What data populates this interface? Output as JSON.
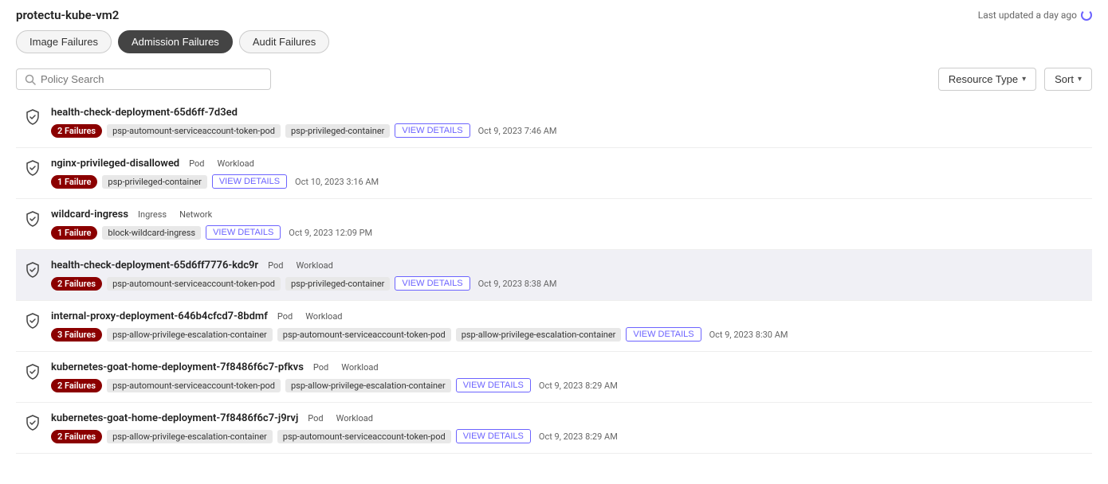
{
  "app": {
    "title": "protectu-kube-vm2",
    "last_updated": "Last updated a day ago"
  },
  "tabs": [
    {
      "id": "image-failures",
      "label": "Image Failures",
      "active": false
    },
    {
      "id": "admission-failures",
      "label": "Admission Failures",
      "active": true
    },
    {
      "id": "audit-failures",
      "label": "Audit Failures",
      "active": false
    }
  ],
  "toolbar": {
    "search_placeholder": "Policy Search",
    "resource_type_label": "Resource Type",
    "sort_label": "Sort"
  },
  "items": [
    {
      "id": "item-1",
      "name": "health-check-deployment-65d6ff-7d3ed",
      "type1": "",
      "type2": "",
      "highlighted": false,
      "failures_count": "2 Failures",
      "tags": [
        "psp-automount-serviceaccount-token-pod",
        "psp-privileged-container"
      ],
      "view_details": "VIEW DETAILS",
      "date": "Oct 9, 2023 7:46 AM"
    },
    {
      "id": "item-2",
      "name": "nginx-privileged-disallowed",
      "type1": "Pod",
      "type2": "Workload",
      "highlighted": false,
      "failures_count": "1 Failure",
      "tags": [
        "psp-privileged-container"
      ],
      "view_details": "VIEW DETAILS",
      "date": "Oct 10, 2023 3:16 AM"
    },
    {
      "id": "item-3",
      "name": "wildcard-ingress",
      "type1": "Ingress",
      "type2": "Network",
      "highlighted": false,
      "failures_count": "1 Failure",
      "tags": [
        "block-wildcard-ingress"
      ],
      "view_details": "VIEW DETAILS",
      "date": "Oct 9, 2023 12:09 PM"
    },
    {
      "id": "item-4",
      "name": "health-check-deployment-65d6ff7776-kdc9r",
      "type1": "Pod",
      "type2": "Workload",
      "highlighted": true,
      "failures_count": "2 Failures",
      "tags": [
        "psp-automount-serviceaccount-token-pod",
        "psp-privileged-container"
      ],
      "view_details": "VIEW DETAILS",
      "date": "Oct 9, 2023 8:38 AM"
    },
    {
      "id": "item-5",
      "name": "internal-proxy-deployment-646b4cfcd7-8bdmf",
      "type1": "Pod",
      "type2": "Workload",
      "highlighted": false,
      "failures_count": "3 Failures",
      "tags": [
        "psp-allow-privilege-escalation-container",
        "psp-automount-serviceaccount-token-pod",
        "psp-allow-privilege-escalation-container"
      ],
      "view_details": "VIEW DETAILS",
      "date": "Oct 9, 2023 8:30 AM"
    },
    {
      "id": "item-6",
      "name": "kubernetes-goat-home-deployment-7f8486f6c7-pfkvs",
      "type1": "Pod",
      "type2": "Workload",
      "highlighted": false,
      "failures_count": "2 Failures",
      "tags": [
        "psp-automount-serviceaccount-token-pod",
        "psp-allow-privilege-escalation-container"
      ],
      "view_details": "VIEW DETAILS",
      "date": "Oct 9, 2023 8:29 AM"
    },
    {
      "id": "item-7",
      "name": "kubernetes-goat-home-deployment-7f8486f6c7-j9rvj",
      "type1": "Pod",
      "type2": "Workload",
      "highlighted": false,
      "failures_count": "2 Failures",
      "tags": [
        "psp-allow-privilege-escalation-container",
        "psp-automount-serviceaccount-token-pod"
      ],
      "view_details": "VIEW DETAILS",
      "date": "Oct 9, 2023 8:29 AM"
    }
  ]
}
